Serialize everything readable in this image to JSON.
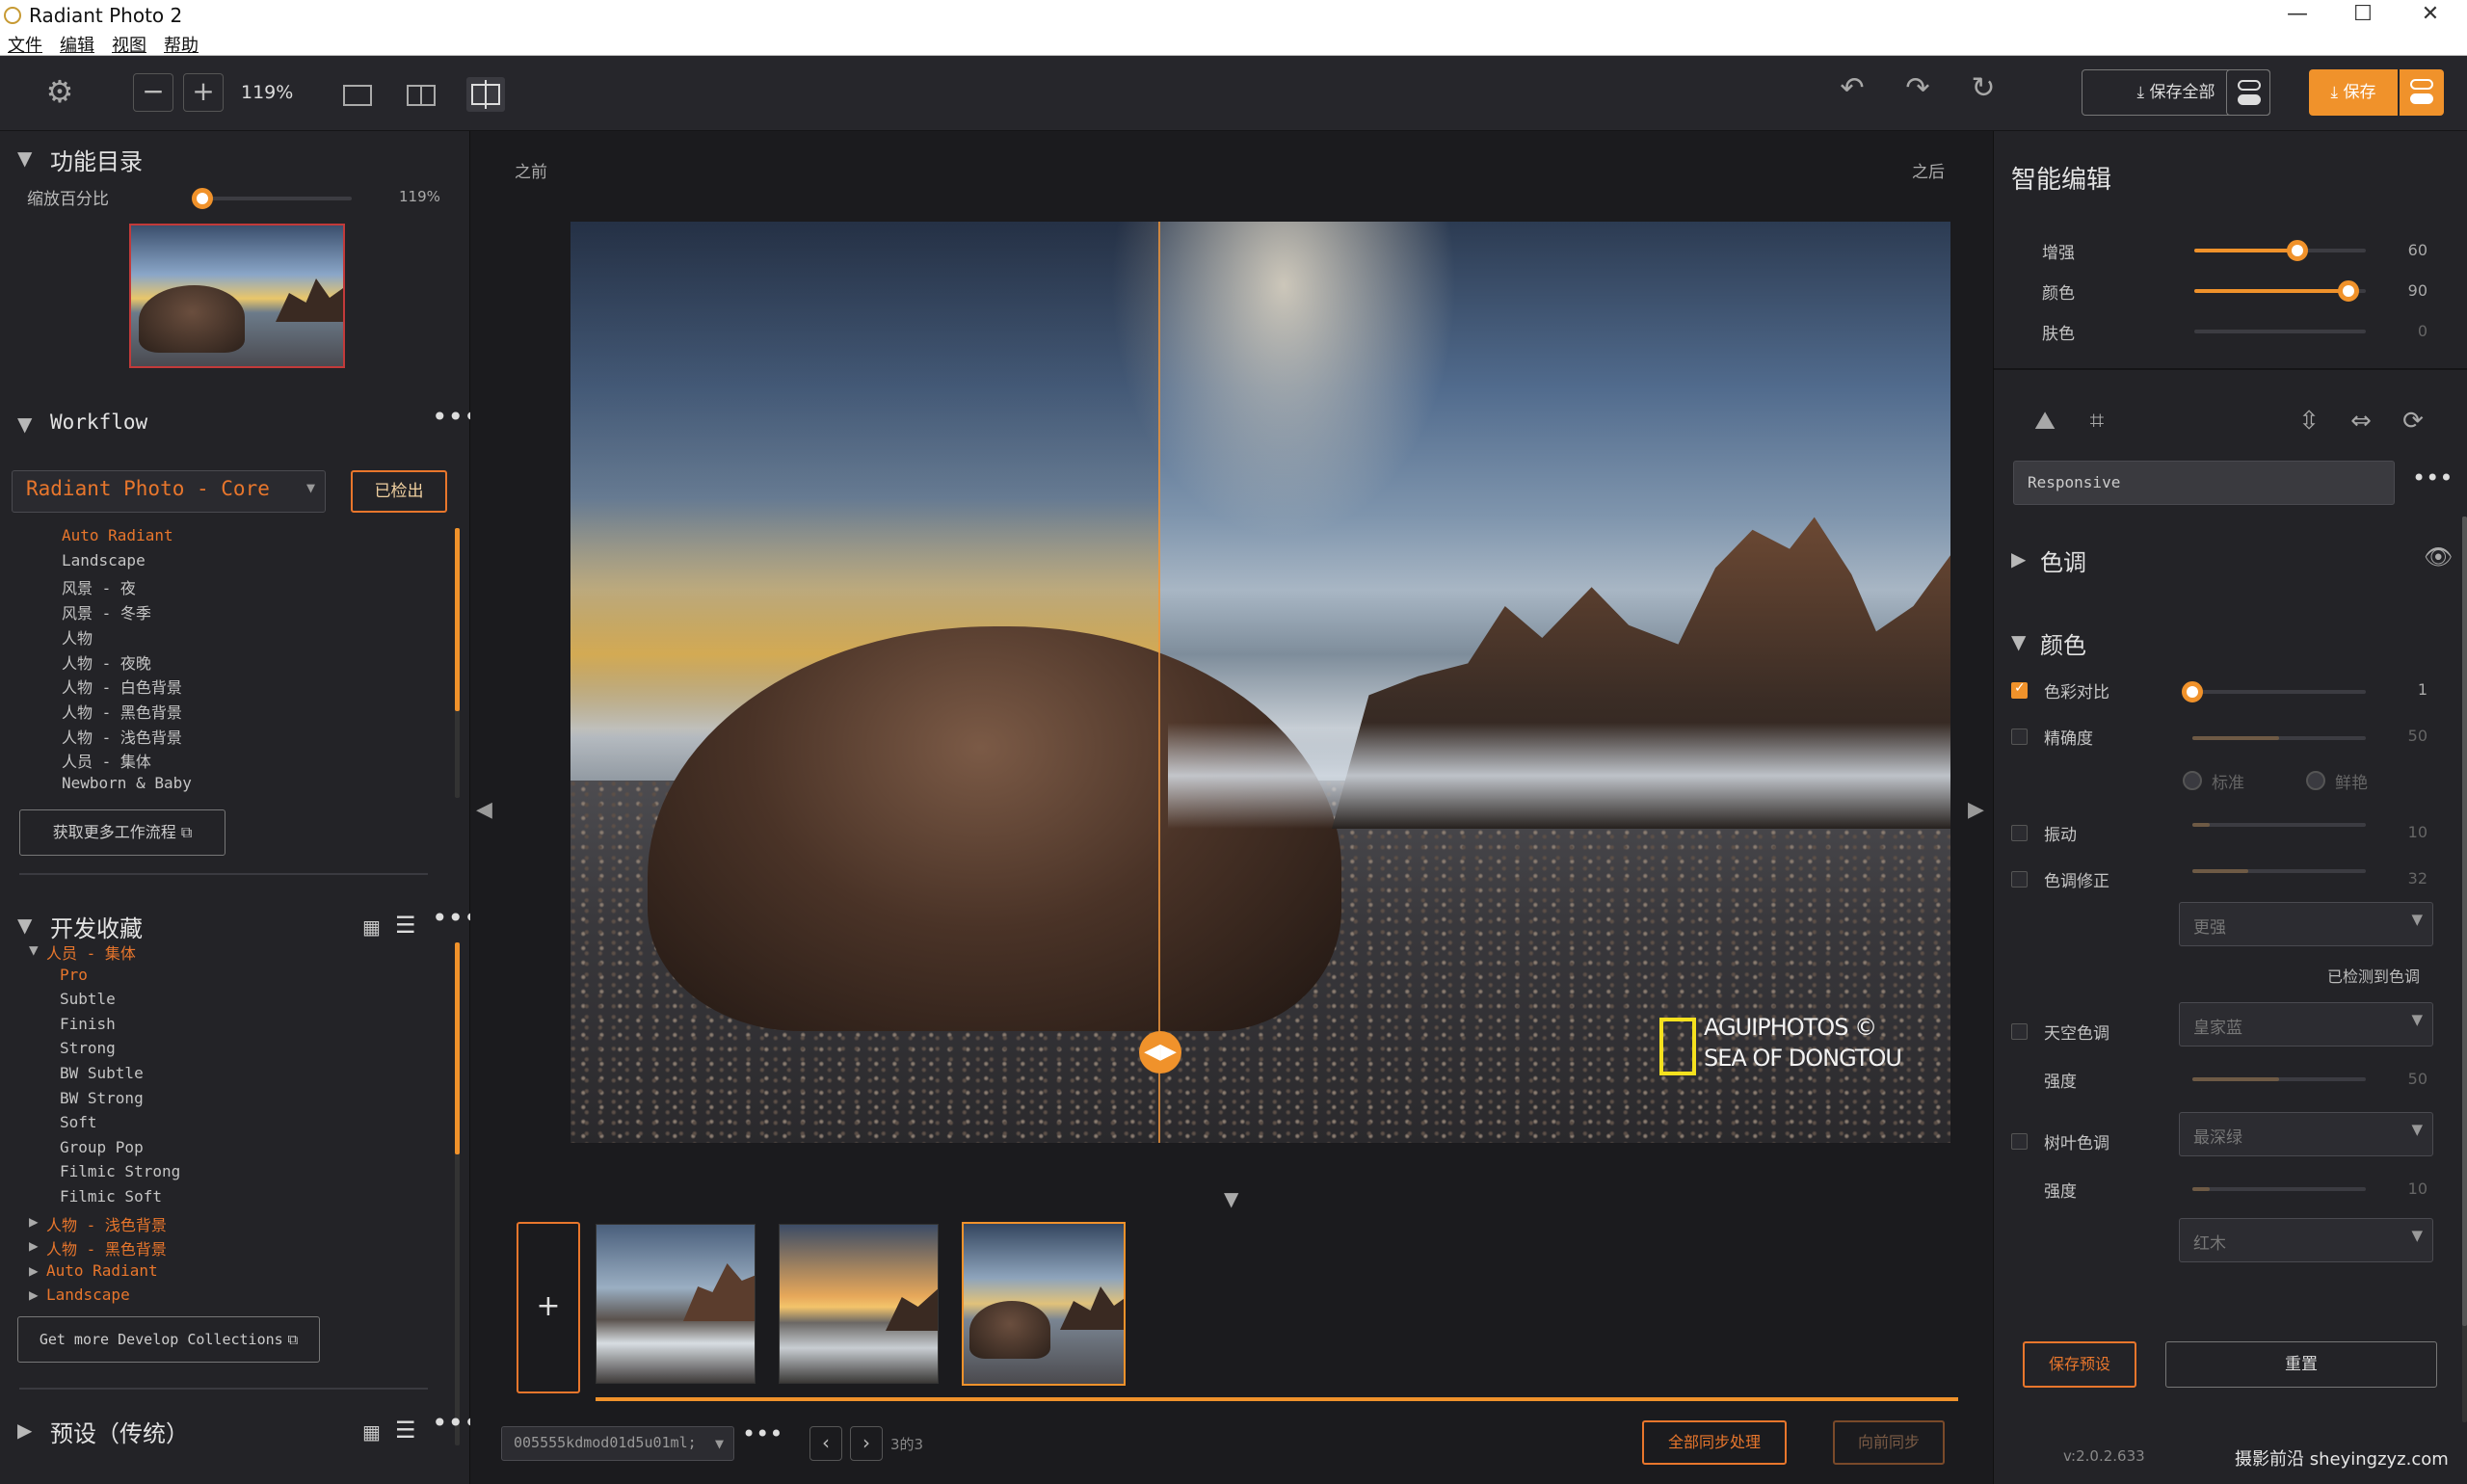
{
  "window": {
    "title": "Radiant Photo 2",
    "controls": [
      "—",
      "☐",
      "✕"
    ]
  },
  "menu": [
    "文件",
    "编辑",
    "视图",
    "帮助"
  ],
  "toolbar": {
    "zoom": "119%",
    "save_all": "保存全部",
    "save": "保存",
    "icons": [
      "gear-icon",
      "zoom-out-icon",
      "zoom-in-icon",
      "single-view-icon",
      "split-view-icon",
      "compare-view-icon",
      "undo-icon",
      "redo-icon",
      "reset-icon"
    ]
  },
  "left": {
    "catalog_title": "功能目录",
    "zoom_label": "缩放百分比",
    "zoom_value": "119%",
    "zoom_level": 0.06,
    "workflow_title": "Workflow",
    "workflow_select": "Radiant Photo - Core",
    "detected_btn": "已检出",
    "workflow_items": [
      "Auto Radiant",
      "Landscape",
      "风景 - 夜",
      "风景 - 冬季",
      "人物",
      "人物 - 夜晚",
      "人物 - 白色背景",
      "人物 - 黑色背景",
      "人物 - 浅色背景",
      "人员 - 集体",
      "Newborn & Baby"
    ],
    "get_more_workflows": "获取更多工作流程",
    "dev_title": "开发收藏",
    "dev_group_open": "人员 - 集体",
    "dev_items": [
      "Pro",
      "Subtle",
      "Finish",
      "Strong",
      "BW Subtle",
      "BW Strong",
      "Soft",
      "Group Pop",
      "Filmic Strong",
      "Filmic Soft"
    ],
    "dev_groups_closed": [
      "人物 - 浅色背景",
      "人物 - 黑色背景",
      "Auto Radiant",
      "Landscape"
    ],
    "get_more_dev": "Get more Develop Collections",
    "presets_title": "预设（传统）"
  },
  "center": {
    "before": "之前",
    "after": "之后",
    "watermark_1": "AGUIPHOTOS ©",
    "watermark_2": "SEA OF DONGTOU",
    "add_btn": "+",
    "filename": "005555kdmod01d5u01ml;",
    "page_info": "3的3",
    "sync_all": "全部同步处理",
    "sync_forward": "向前同步"
  },
  "right": {
    "title": "智能编辑",
    "sliders": [
      {
        "label": "增强",
        "value": "60",
        "level": 0.6
      },
      {
        "label": "颜色",
        "value": "90",
        "level": 0.9
      },
      {
        "label": "肤色",
        "value": "0",
        "level": 0.0
      }
    ],
    "preset_select": "Responsive",
    "tone_title": "色调",
    "color_title": "颜色",
    "color_contrast": {
      "label": "色彩对比",
      "value": "1",
      "level": 0.0
    },
    "precision": {
      "label": "精确度",
      "value": "50",
      "level": 0.5
    },
    "radio_standard": "标准",
    "radio_vivid": "鲜艳",
    "vibrance": {
      "label": "振动",
      "value": "10",
      "level": 0.1
    },
    "tone_fix": {
      "label": "色调修正",
      "value": "32",
      "level": 0.32
    },
    "stronger_select": "更强",
    "detected_tone": "已检测到色调",
    "sky_tone": {
      "label": "天空色调",
      "select": "皇家蓝"
    },
    "sky_strength": {
      "label": "强度",
      "value": "50",
      "level": 0.5
    },
    "foliage": {
      "label": "树叶色调",
      "select": "最深绿"
    },
    "foliage_strength": {
      "label": "强度",
      "value": "10",
      "level": 0.1
    },
    "wood_select": "红木",
    "save_preset": "保存预设",
    "reset": "重置",
    "version": "v:2.0.2.633",
    "site": "摄影前沿 sheyingzyz.com"
  }
}
